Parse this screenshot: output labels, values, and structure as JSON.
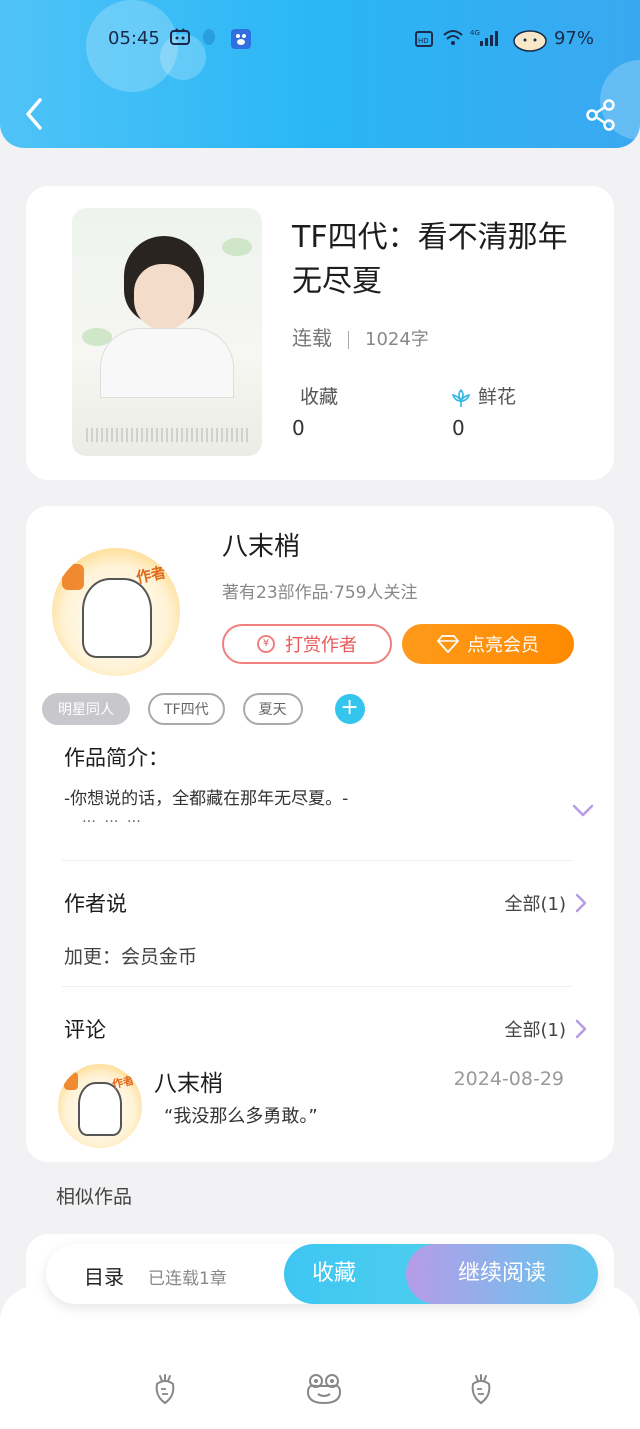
{
  "status_bar": {
    "time": "05:45",
    "network": "4G",
    "battery": "97%"
  },
  "book": {
    "title": "TF四代：看不清那年无尽夏",
    "status": "连载",
    "words": "1024字",
    "stats": {
      "favorites_label": "收藏",
      "favorites_value": "0",
      "flowers_label": "鲜花",
      "flowers_value": "0"
    }
  },
  "author": {
    "name": "八末梢",
    "subtitle": "著有23部作品·759人关注",
    "badge": "作者",
    "reward_label": "打赏作者",
    "vip_label": "点亮会员"
  },
  "tags": [
    "明星同人",
    "TF四代",
    "夏天"
  ],
  "intro": {
    "title": "作品简介：",
    "text": "-你想说的话，全都藏在那年无尽夏。-",
    "more": "… … …"
  },
  "author_says": {
    "title": "作者说",
    "all_label": "全部(1)",
    "text": "加更：会员金币"
  },
  "comments": {
    "title": "评论",
    "all_label": "全部(1)",
    "items": [
      {
        "user": "八末梢",
        "date": "2024-08-29",
        "text": "“我没那么多勇敢。”"
      }
    ]
  },
  "similar_title": "相似作品",
  "action_bar": {
    "toc_label": "目录",
    "chapters": "已连载1章",
    "favorite_label": "收藏",
    "read_label": "继续阅读"
  },
  "colors": {
    "header": "#29b6f6",
    "vip": "#ff9a1a",
    "reward": "#e85a5a",
    "accent_purple": "#b69ce8"
  }
}
